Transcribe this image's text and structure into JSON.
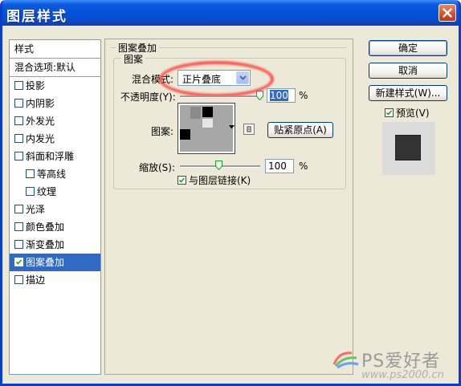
{
  "window": {
    "title": "图层样式"
  },
  "left_panel": {
    "header": "样式",
    "blend_default": "混合选项:默认",
    "items": [
      {
        "label": "投影",
        "checked": false,
        "indent": false,
        "selected": false
      },
      {
        "label": "内阴影",
        "checked": false,
        "indent": false,
        "selected": false
      },
      {
        "label": "外发光",
        "checked": false,
        "indent": false,
        "selected": false
      },
      {
        "label": "内发光",
        "checked": false,
        "indent": false,
        "selected": false
      },
      {
        "label": "斜面和浮雕",
        "checked": false,
        "indent": false,
        "selected": false
      },
      {
        "label": "等高线",
        "checked": false,
        "indent": true,
        "selected": false
      },
      {
        "label": "纹理",
        "checked": false,
        "indent": true,
        "selected": false
      },
      {
        "label": "光泽",
        "checked": false,
        "indent": false,
        "selected": false
      },
      {
        "label": "颜色叠加",
        "checked": false,
        "indent": false,
        "selected": false
      },
      {
        "label": "渐变叠加",
        "checked": false,
        "indent": false,
        "selected": false
      },
      {
        "label": "图案叠加",
        "checked": true,
        "indent": false,
        "selected": true
      },
      {
        "label": "描边",
        "checked": false,
        "indent": false,
        "selected": false
      }
    ]
  },
  "pattern_overlay": {
    "section_title": "图案叠加",
    "group_title": "图案",
    "blend_mode_label": "混合模式:",
    "blend_mode_value": "正片叠底",
    "opacity_label": "不透明度(Y):",
    "opacity_value": "100",
    "opacity_unit": "%",
    "pattern_label": "图案:",
    "snap_origin_button": "贴紧原点(A)",
    "scale_label": "缩放(S):",
    "scale_value": "100",
    "scale_unit": "%",
    "link_label": "与图层链接(K)",
    "link_checked": true
  },
  "buttons": {
    "ok": "确定",
    "cancel": "取消",
    "new_style": "新建样式(W)...",
    "preview_label": "预览(V)",
    "preview_checked": true
  },
  "watermark": {
    "brand": "PS爱好者",
    "url": "www.ps2000.cn"
  },
  "colors": {
    "titlebar": "#0550d8",
    "selection": "#316ac5",
    "dialog_bg": "#ece9d8",
    "highlight": "#ff3333"
  }
}
